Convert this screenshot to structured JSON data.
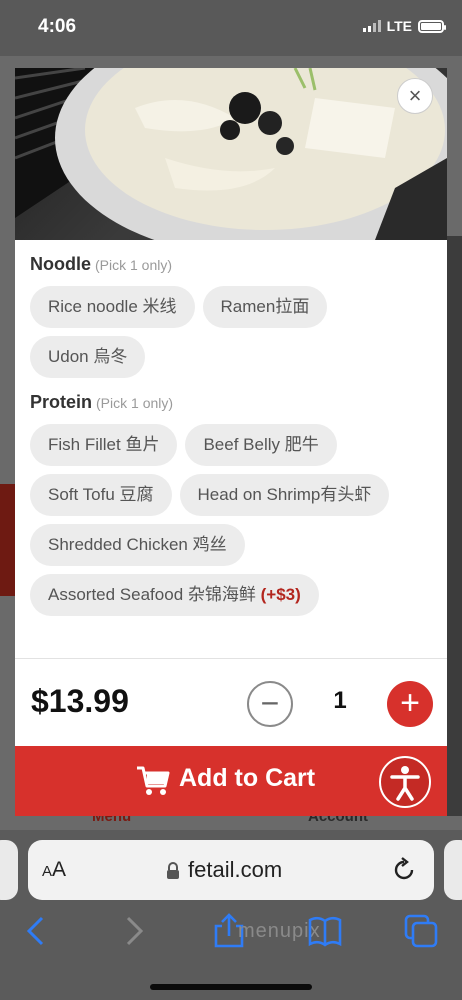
{
  "status_bar": {
    "time": "4:06",
    "network": "LTE"
  },
  "background_page": {
    "menu_label": "Menu",
    "account_label": "Account"
  },
  "modal": {
    "close_symbol": "×",
    "sections": [
      {
        "name": "Noodle",
        "hint": "(Pick 1 only)",
        "options": [
          "Rice noodle 米线",
          "Ramen拉面",
          "Udon 烏冬"
        ]
      },
      {
        "name": "Protein",
        "hint": "(Pick 1 only)",
        "options": [
          "Fish Fillet 鱼片",
          "Beef Belly 肥牛",
          "Soft Tofu 豆腐",
          "Head on Shrimp有头虾",
          "Shredded Chicken 鸡丝"
        ],
        "last_option": {
          "label": "Assorted Seafood 杂锦海鲜",
          "extra": "(+$3)"
        }
      }
    ],
    "price": "$13.99",
    "minus_symbol": "−",
    "quantity": "1",
    "plus_symbol": "+",
    "add_to_cart_label": "Add to Cart"
  },
  "browser": {
    "aa_small": "A",
    "aa_large": "A",
    "url": "fetail.com",
    "watermark": "menupix"
  },
  "colors": {
    "accent": "#d7312c",
    "chip_bg": "#ececec",
    "surcharge": "#b3261e",
    "ios_blue": "#2f7cf6"
  },
  "icons": [
    "close-icon",
    "cart-icon",
    "accessibility-icon",
    "lock-icon",
    "reload-icon",
    "back-icon",
    "forward-icon",
    "share-icon",
    "bookmarks-icon",
    "tabs-icon"
  ]
}
